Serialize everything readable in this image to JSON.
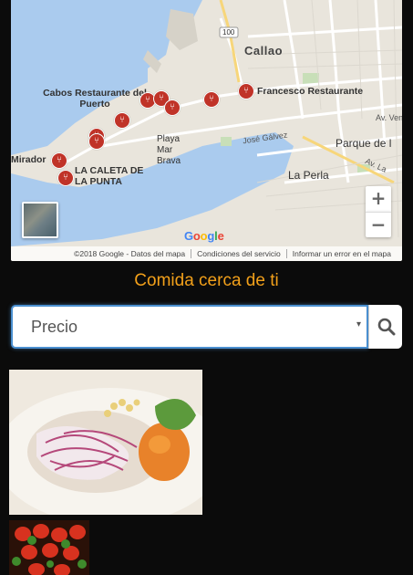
{
  "map": {
    "city_label": "Callao",
    "road_shield": "100",
    "labels": {
      "cabos": "Cabos Restaurante del Puerto",
      "francesco": "Francesco Restaurante",
      "playa": "Playa Mar Brava",
      "jose_galvez": "José Gálvez",
      "caleta": "LA CALETA DE LA PUNTA",
      "mirador": "Mirador",
      "la_perla": "La Perla",
      "parque": "Parque de l",
      "av_venez": "Av. Vene",
      "av_la": "Av. La"
    },
    "zoom_in_label": "+",
    "zoom_out_label": "−",
    "google_logo": [
      "G",
      "o",
      "o",
      "g",
      "l",
      "e"
    ],
    "google_colors": [
      "#4285F4",
      "#EA4335",
      "#FBBC05",
      "#4285F4",
      "#34A853",
      "#EA4335"
    ],
    "attribution": {
      "data": "©2018 Google - Datos del mapa",
      "terms": "Condiciones del servicio",
      "report": "Informar un error en el mapa"
    },
    "pin_icon": "fork-knife-icon",
    "colors": {
      "land": "#e9e5dc",
      "water": "#a9c8f0",
      "pin": "#c03328",
      "road": "#ffffff"
    }
  },
  "heading": "Comida cerca de ti",
  "filter": {
    "selected": "Precio",
    "arrow": "▾"
  },
  "search": {
    "icon": "search-icon"
  },
  "accent_color": "#f2a01a"
}
